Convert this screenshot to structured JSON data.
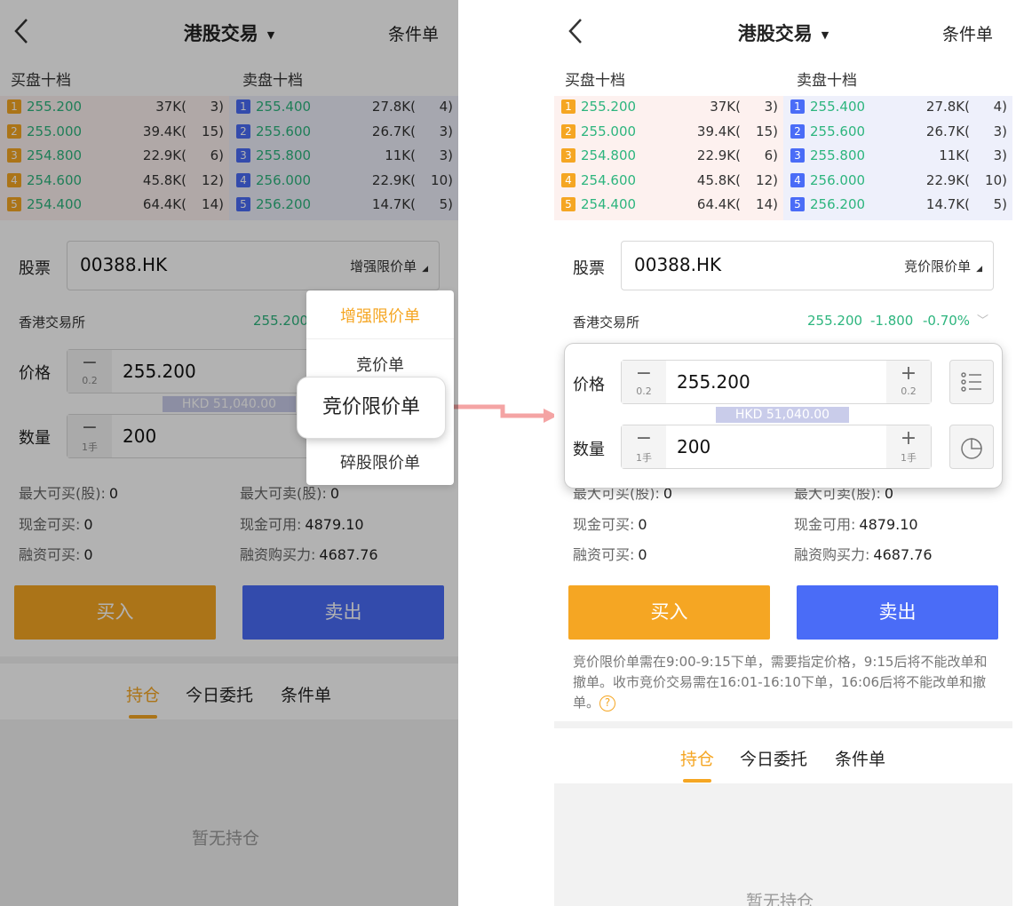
{
  "nav": {
    "title": "港股交易",
    "right": "条件单"
  },
  "orderbook": {
    "buy_header": "买盘十档",
    "sell_header": "卖盘十档",
    "buy": [
      {
        "idx": "1",
        "price": "255.200",
        "vol": "37K(",
        "cnt": "3)"
      },
      {
        "idx": "2",
        "price": "255.000",
        "vol": "39.4K(",
        "cnt": "15)"
      },
      {
        "idx": "3",
        "price": "254.800",
        "vol": "22.9K(",
        "cnt": "6)"
      },
      {
        "idx": "4",
        "price": "254.600",
        "vol": "45.8K(",
        "cnt": "12)"
      },
      {
        "idx": "5",
        "price": "254.400",
        "vol": "64.4K(",
        "cnt": "14)"
      }
    ],
    "sell": [
      {
        "idx": "1",
        "price": "255.400",
        "vol": "27.8K(",
        "cnt": "4)"
      },
      {
        "idx": "2",
        "price": "255.600",
        "vol": "26.7K(",
        "cnt": "3)"
      },
      {
        "idx": "3",
        "price": "255.800",
        "vol": "11K(",
        "cnt": "3)"
      },
      {
        "idx": "4",
        "price": "256.000",
        "vol": "22.9K(",
        "cnt": "10)"
      },
      {
        "idx": "5",
        "price": "256.200",
        "vol": "14.7K(",
        "cnt": "5)"
      }
    ]
  },
  "form": {
    "stock_label": "股票",
    "stock_code": "00388.HK",
    "exchange": "香港交易所",
    "price_label": "价格",
    "price_value": "255.200",
    "price_step": "0.2",
    "hkd": "HKD 51,040.00",
    "qty_label": "数量",
    "qty_value": "200",
    "qty_step": "1手"
  },
  "left": {
    "order_type": "增强限价单",
    "quote_price": "255.200"
  },
  "right": {
    "order_type": "竞价限价单",
    "quote_price": "255.200",
    "quote_change": "-1.800",
    "quote_pct": "-0.70%"
  },
  "dropdown": {
    "items": [
      "增强限价单",
      "竞价单",
      "竞价限价单",
      "碎股限价单"
    ],
    "selected_index": 0,
    "highlight_index": 2
  },
  "account": {
    "max_buy_label": "最大可买(股):",
    "max_buy": "0",
    "max_sell_label": "最大可卖(股):",
    "max_sell": "0",
    "cash_buy_label": "现金可买:",
    "cash_buy": "0",
    "cash_avail_label": "现金可用:",
    "cash_avail": "4879.10",
    "margin_buy_label": "融资可买:",
    "margin_buy": "0",
    "margin_power_label": "融资购买力:",
    "margin_power": "4687.76"
  },
  "actions": {
    "buy": "买入",
    "sell": "卖出"
  },
  "note": "竞价限价单需在9:00-9:15下单，需要指定价格，9:15后将不能改单和撤单。收市竞价交易需在16:01-16:10下单，16:06后将不能改单和撤单。",
  "note_help": "?",
  "tabs": [
    "持仓",
    "今日委托",
    "条件单"
  ],
  "empty_text": "暂无持仓",
  "colors": {
    "accent": "#f5a623",
    "sell": "#4a6cf7",
    "up_green": "#2db57e",
    "arrow": "#f4a4a4"
  }
}
